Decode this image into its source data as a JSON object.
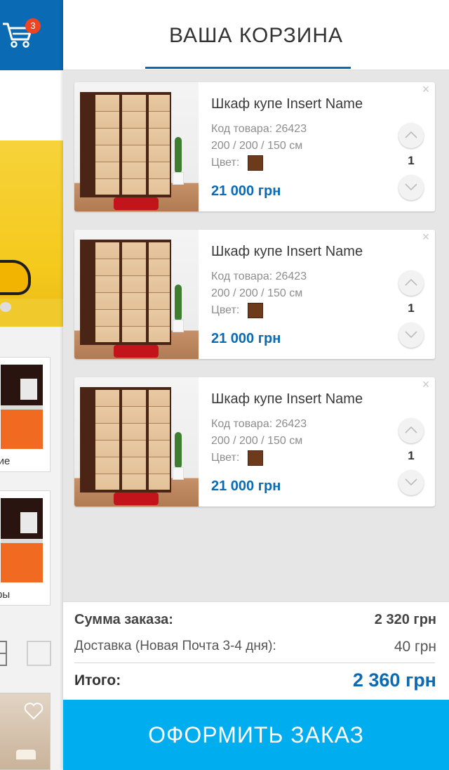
{
  "background": {
    "cart_badge_count": "3",
    "category_cards": [
      {
        "label": "кие"
      },
      {
        "label": "фы"
      }
    ]
  },
  "cart": {
    "title": "ВАША КОРЗИНА",
    "close_symbol": "×",
    "items": [
      {
        "name": "Шкаф купе Insert Name",
        "code": "Код товара: 26423",
        "size": "200 / 200 / 150 см",
        "color_label": "Цвет:",
        "color": "#6e3a1c",
        "price": "21 000 грн",
        "quantity": "1"
      },
      {
        "name": "Шкаф купе Insert Name",
        "code": "Код товара: 26423",
        "size": "200 / 200 / 150 см",
        "color_label": "Цвет:",
        "color": "#6e3a1c",
        "price": "21 000 грн",
        "quantity": "1"
      },
      {
        "name": "Шкаф купе Insert Name",
        "code": "Код товара: 26423",
        "size": "200 / 200 / 150 см",
        "color_label": "Цвет:",
        "color": "#6e3a1c",
        "price": "21 000 грн",
        "quantity": "1"
      }
    ]
  },
  "summary": {
    "subtotal_label": "Сумма заказа:",
    "subtotal_value": "2 320 грн",
    "delivery_label": "Доставка (Новая Почта 3-4 дня):",
    "delivery_value": "40 грн",
    "total_label": "Итого:",
    "total_value": "2 360 грн"
  },
  "checkout_label": "ОФОРМИТЬ ЗАКАЗ",
  "colors": {
    "brand_blue": "#0a6ab4",
    "checkout_cyan": "#00aeef",
    "badge_red": "#ee4422"
  }
}
